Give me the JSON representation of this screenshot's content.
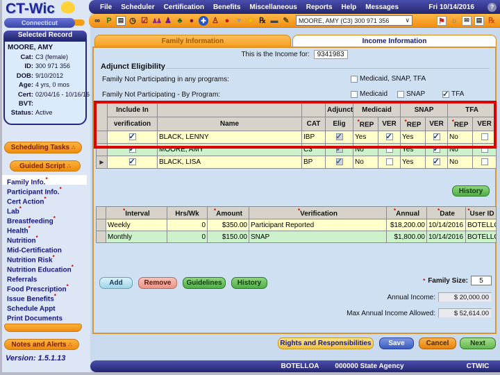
{
  "ui": {
    "asterisk": "*",
    "caret": "∨",
    "arrow": "▶",
    "help": "?"
  },
  "menubar": {
    "items": [
      "File",
      "Scheduler",
      "Certification",
      "Benefits",
      "Miscellaneous",
      "Reports",
      "Help",
      "Messages"
    ],
    "date": "Fri 10/14/2016"
  },
  "toolbar": {
    "icons_left": [
      {
        "name": "binoculars-icon",
        "glyph": "∞"
      },
      {
        "name": "letter-p-icon",
        "glyph": "P"
      },
      {
        "name": "notebook-icon",
        "glyph": "▤"
      },
      {
        "name": "clock-icon",
        "glyph": "◷"
      },
      {
        "name": "checklist-icon",
        "glyph": "☑"
      },
      {
        "name": "family-icon",
        "glyph": "♟♟"
      },
      {
        "name": "person-icon",
        "glyph": "♟"
      },
      {
        "name": "tree-icon",
        "glyph": "♣"
      },
      {
        "name": "grapes-icon",
        "glyph": "●"
      },
      {
        "name": "plus-icon",
        "glyph": "✚"
      },
      {
        "name": "scale-icon",
        "glyph": "♙"
      },
      {
        "name": "apple-icon",
        "glyph": "●"
      },
      {
        "name": "heart-icon",
        "glyph": "♥"
      },
      {
        "name": "star-icon",
        "glyph": "★"
      },
      {
        "name": "rx-icon",
        "glyph": "℞"
      },
      {
        "name": "card-icon",
        "glyph": "▬"
      },
      {
        "name": "edit-icon",
        "glyph": "✎"
      }
    ],
    "record_dropdown": "MOORE, AMY (C3) 300 971 356",
    "icons_right": [
      {
        "name": "note-icon",
        "glyph": "⚑"
      },
      {
        "name": "bulb-icon",
        "glyph": "☼"
      },
      {
        "name": "envelope-icon",
        "glyph": "✉"
      },
      {
        "name": "document-icon",
        "glyph": "▤"
      },
      {
        "name": "rx-orange-icon",
        "glyph": "℞"
      }
    ]
  },
  "sidebar": {
    "logo": {
      "title": "CT-Wic",
      "subtitle": "Connecticut"
    },
    "selected_record_header": "Selected Record",
    "record": {
      "name": "MOORE, AMY",
      "fields": [
        {
          "label": "Cat:",
          "value": "C3 (female)"
        },
        {
          "label": "ID:",
          "value": "300 971 356"
        },
        {
          "label": "DOB:",
          "value": "9/10/2012"
        },
        {
          "label": "Age:",
          "value": "4 yrs, 0 mos"
        },
        {
          "label": "Cert:",
          "value": "02/04/16 - 10/16/16"
        },
        {
          "label": "BVT:",
          "value": ""
        },
        {
          "label": "Status:",
          "value": "Active"
        }
      ]
    },
    "scheduling_tasks": "Scheduling Tasks",
    "guided_script": "Guided Script",
    "menu": [
      {
        "label": "Family Info.",
        "mark": "*"
      },
      {
        "label": "Participant Info.",
        "mark": "*"
      },
      {
        "label": "Cert Action",
        "mark": "*"
      },
      {
        "label": "Lab",
        "mark": "*"
      },
      {
        "label": "Breastfeeding",
        "mark": "*"
      },
      {
        "label": "Health",
        "mark": "*"
      },
      {
        "label": "Nutrition",
        "mark": "*"
      },
      {
        "label": "Mid-Certification",
        "mark": ""
      },
      {
        "label": "Nutrition Risk",
        "mark": "*"
      },
      {
        "label": "Nutrition Education",
        "mark": "*"
      },
      {
        "label": "Referrals",
        "mark": ""
      },
      {
        "label": "Food Prescription",
        "mark": "*"
      },
      {
        "label": "Issue Benefits",
        "mark": "*"
      },
      {
        "label": "Schedule Appt",
        "mark": ""
      },
      {
        "label": "Print Documents",
        "mark": ""
      }
    ],
    "notes_and_alerts": "Notes and Alerts",
    "version": "Version: 1.5.1.13"
  },
  "tabs": [
    {
      "label": "Family Information"
    },
    {
      "label": "Income Information"
    }
  ],
  "main": {
    "income_for": {
      "label": "This is the Income for:",
      "value": "9341983"
    },
    "adjunct": {
      "title": "Adjunct Eligibility",
      "row1_label": "Family Not Participating in any programs:",
      "row1_option": {
        "label": "Medicaid, SNAP, TFA",
        "state": "off"
      },
      "row2_label": "Family Not Participating - By Program:",
      "row2_options": [
        {
          "label": "Medicaid",
          "state": "off"
        },
        {
          "label": "SNAP",
          "state": "off"
        },
        {
          "label": "TFA",
          "state": "on"
        }
      ]
    },
    "participants": {
      "header": {
        "include_top": "Include In",
        "include_bottom": "verification",
        "name": "Name",
        "cat": "CAT",
        "adjunct_top": "Adjunct",
        "adjunct_bottom": "Elig",
        "medicaid": "Medicaid",
        "snap": "SNAP",
        "tfa": "TFA",
        "rep": "REP",
        "ver": "VER"
      },
      "rows": [
        {
          "include": "on",
          "name": "BLACK, LENNY",
          "cat": "IBP",
          "elig": "on-dis",
          "med_rep": "Yes",
          "med_ver": "on",
          "snap_rep": "Yes",
          "snap_ver": "on",
          "tfa_rep": "No",
          "tfa_ver": "off",
          "arrow": ""
        },
        {
          "include": "on",
          "name": "MOORE, AMY",
          "cat": "C3",
          "elig": "on-dis",
          "med_rep": "No",
          "med_ver": "off",
          "snap_rep": "Yes",
          "snap_ver": "on",
          "tfa_rep": "No",
          "tfa_ver": "off",
          "arrow": ""
        },
        {
          "include": "on",
          "name": "BLACK, LISA",
          "cat": "BP",
          "elig": "on-dis",
          "med_rep": "No",
          "med_ver": "off",
          "snap_rep": "Yes",
          "snap_ver": "on",
          "tfa_rep": "No",
          "tfa_ver": "off",
          "arrow": "▶"
        }
      ]
    },
    "income": {
      "headers": [
        {
          "mark": "*",
          "label": "Interval"
        },
        {
          "mark": "",
          "label": "Hrs/Wk"
        },
        {
          "mark": "*",
          "label": "Amount"
        },
        {
          "mark": "*",
          "label": "Verification"
        },
        {
          "mark": "*",
          "label": "Annual"
        },
        {
          "mark": "*",
          "label": "Date"
        },
        {
          "mark": "*",
          "label": "User ID"
        }
      ],
      "rows": [
        {
          "interval": "Weekly",
          "hrs": "0",
          "amount": "$350.00",
          "verification": "Participant Reported",
          "annual": "$18,200.00",
          "date": "10/14/2016",
          "user": "BOTELLOA"
        },
        {
          "interval": "Monthly",
          "hrs": "0",
          "amount": "$150.00",
          "verification": "SNAP",
          "annual": "$1,800.00",
          "date": "10/14/2016",
          "user": "BOTELLOA"
        }
      ]
    },
    "buttons": {
      "history_top": "History",
      "add": "Add",
      "remove": "Remove",
      "guidelines": "Guidelines",
      "history": "History",
      "rights": "Rights and Responsibilities",
      "save": "Save",
      "cancel": "Cancel",
      "next": "Next"
    },
    "totals": {
      "family_size_label": "Family Size:",
      "family_size": "5",
      "annual_income_label": "Annual Income:",
      "annual_income": "$ 20,000.00",
      "max_annual_label": "Max Annual Income Allowed:",
      "max_annual": "$ 52,614.00"
    },
    "highlight_color": "#dd0000"
  },
  "statusbar": {
    "user": "BOTELLOA",
    "agency": "000000 State Agency",
    "app": "CTWIC"
  }
}
